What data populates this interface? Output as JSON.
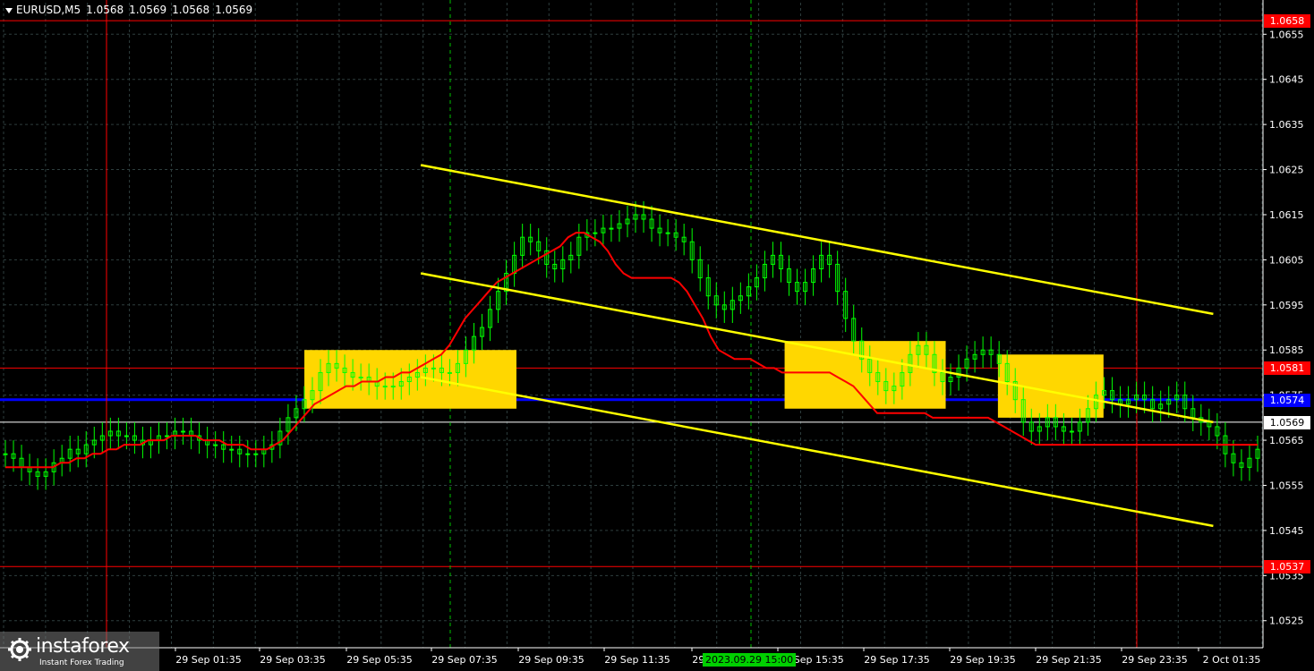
{
  "header": {
    "symbol": "EURUSD,M5",
    "open": "1.0568",
    "high": "1.0569",
    "low": "1.0568",
    "close": "1.0569"
  },
  "watermark": {
    "brand": "instaforex",
    "tagline": "Instant Forex Trading"
  },
  "crosshair_time_label": "2023.09.29 15:00",
  "colors": {
    "background": "#000000",
    "grid": "#2e3e3e",
    "bull_candle": "#00ff00",
    "ma_line": "#ff0000",
    "channel": "#ffff00",
    "box": "#ffd700",
    "support_red": "#ff0000",
    "pivot_blue": "#0000ff",
    "price_tag_red": "#ff0000",
    "price_tag_blue": "#0000ff",
    "time_tag_green": "#00d000"
  },
  "chart_data": {
    "type": "candlestick",
    "ylim": [
      1.0519,
      1.0662
    ],
    "y_ticks": [
      "1.0655",
      "1.0645",
      "1.0635",
      "1.0625",
      "1.0615",
      "1.0605",
      "1.0595",
      "1.0585",
      "1.0575",
      "1.0565",
      "1.0555",
      "1.0545",
      "1.0535",
      "1.0525"
    ],
    "x_ticks": [
      "29 Sep 01:35",
      "29 Sep 03:35",
      "29 Sep 05:35",
      "29 Sep 07:35",
      "29 Sep 09:35",
      "29 Sep 11:35",
      "29 Sep 13:35",
      "29 Sep 15:35",
      "29 Sep 17:35",
      "29 Sep 19:35",
      "29 Sep 21:35",
      "29 Sep 23:35",
      "2 Oct 01:35"
    ],
    "price_levels": [
      {
        "label": "1.0658",
        "value": 1.0658,
        "color": "red"
      },
      {
        "label": "1.0581",
        "value": 1.0581,
        "color": "red"
      },
      {
        "label": "1.0574",
        "value": 1.0574,
        "color": "blue"
      },
      {
        "label": "1.0569",
        "value": 1.0569,
        "color": "white"
      },
      {
        "label": "1.0537",
        "value": 1.0537,
        "color": "red"
      }
    ],
    "vertical_red_lines": [
      "29 Sep 00:00",
      "2 Oct 00:00"
    ],
    "vertical_green_dashed": [
      "29 Sep 07:00",
      "29 Sep 15:00"
    ],
    "channels": [
      {
        "x1": 0.3315,
        "y1": 1.0626,
        "x2": 0.9612,
        "y2": 1.0593
      },
      {
        "x1": 0.3315,
        "y1": 1.0602,
        "x2": 0.9612,
        "y2": 1.0569
      },
      {
        "x1": 0.3315,
        "y1": 1.0579,
        "x2": 0.9612,
        "y2": 1.0546
      }
    ],
    "boxes": [
      {
        "x1": 0.239,
        "x2": 0.4075,
        "y_top": 1.0585,
        "y_bottom": 1.0572
      },
      {
        "x1": 0.6206,
        "x2": 0.7486,
        "y_top": 1.0587,
        "y_bottom": 1.0572
      },
      {
        "x1": 0.7901,
        "x2": 0.874,
        "y_top": 1.0584,
        "y_bottom": 1.057
      }
    ],
    "close_series": [
      1.0562,
      1.0561,
      1.0559,
      1.0558,
      1.0557,
      1.0558,
      1.056,
      1.0561,
      1.0563,
      1.0562,
      1.0564,
      1.0565,
      1.0566,
      1.0567,
      1.0566,
      1.0566,
      1.0565,
      1.0564,
      1.0565,
      1.0566,
      1.0566,
      1.0567,
      1.0567,
      1.0566,
      1.0565,
      1.0564,
      1.0564,
      1.0563,
      1.0563,
      1.0562,
      1.0562,
      1.0562,
      1.0563,
      1.0564,
      1.0567,
      1.057,
      1.0572,
      1.0574,
      1.0576,
      1.058,
      1.0582,
      1.0581,
      1.058,
      1.0579,
      1.0579,
      1.0578,
      1.0577,
      1.0577,
      1.0577,
      1.0578,
      1.0579,
      1.058,
      1.0581,
      1.0581,
      1.058,
      1.058,
      1.0582,
      1.0585,
      1.0588,
      1.059,
      1.0594,
      1.0598,
      1.0602,
      1.0606,
      1.061,
      1.0609,
      1.0607,
      1.0604,
      1.0603,
      1.0605,
      1.0606,
      1.061,
      1.0611,
      1.0611,
      1.0612,
      1.0612,
      1.0613,
      1.0614,
      1.0615,
      1.0614,
      1.0612,
      1.0611,
      1.0611,
      1.061,
      1.0609,
      1.0605,
      1.0601,
      1.0597,
      1.0595,
      1.0594,
      1.0596,
      1.0597,
      1.0599,
      1.0601,
      1.0604,
      1.0606,
      1.0603,
      1.06,
      1.0598,
      1.06,
      1.0603,
      1.0606,
      1.0604,
      1.0598,
      1.0592,
      1.0587,
      1.0583,
      1.058,
      1.0578,
      1.0576,
      1.0577,
      1.058,
      1.0584,
      1.0586,
      1.0584,
      1.058,
      1.0578,
      1.0579,
      1.0581,
      1.0583,
      1.0584,
      1.0585,
      1.0584,
      1.0582,
      1.0578,
      1.0574,
      1.0569,
      1.0567,
      1.0568,
      1.057,
      1.0568,
      1.0567,
      1.0567,
      1.0569,
      1.0572,
      1.0575,
      1.0576,
      1.0574,
      1.0573,
      1.0574,
      1.0575,
      1.0574,
      1.0572,
      1.0573,
      1.0574,
      1.0575,
      1.0572,
      1.057,
      1.0569,
      1.0568,
      1.0566,
      1.0562,
      1.056,
      1.0559,
      1.0561,
      1.0563
    ],
    "ma_series": [
      1.0559,
      1.0559,
      1.0559,
      1.0559,
      1.0559,
      1.0559,
      1.0559,
      1.056,
      1.056,
      1.0561,
      1.0561,
      1.0562,
      1.0562,
      1.0563,
      1.0563,
      1.0564,
      1.0564,
      1.0564,
      1.0565,
      1.0565,
      1.0565,
      1.0566,
      1.0566,
      1.0566,
      1.0566,
      1.0565,
      1.0565,
      1.0565,
      1.0564,
      1.0564,
      1.0564,
      1.0563,
      1.0563,
      1.0563,
      1.0564,
      1.0565,
      1.0567,
      1.0569,
      1.0571,
      1.0573,
      1.0574,
      1.0575,
      1.0576,
      1.0577,
      1.0577,
      1.0578,
      1.0578,
      1.0578,
      1.0579,
      1.0579,
      1.058,
      1.058,
      1.0581,
      1.0582,
      1.0583,
      1.0584,
      1.0586,
      1.0589,
      1.0592,
      1.0594,
      1.0596,
      1.0598,
      1.06,
      1.0601,
      1.0602,
      1.0603,
      1.0604,
      1.0605,
      1.0606,
      1.0607,
      1.0608,
      1.061,
      1.0611,
      1.0611,
      1.061,
      1.0609,
      1.0607,
      1.0604,
      1.0602,
      1.0601,
      1.0601,
      1.0601,
      1.0601,
      1.0601,
      1.0601,
      1.06,
      1.0598,
      1.0595,
      1.0592,
      1.0588,
      1.0585,
      1.0584,
      1.0583,
      1.0583,
      1.0583,
      1.0582,
      1.0581,
      1.0581,
      1.058,
      1.058,
      1.058,
      1.058,
      1.058,
      1.058,
      1.058,
      1.0579,
      1.0578,
      1.0577,
      1.0575,
      1.0573,
      1.0571,
      1.0571,
      1.0571,
      1.0571,
      1.0571,
      1.0571,
      1.0571,
      1.057,
      1.057,
      1.057,
      1.057,
      1.057,
      1.057,
      1.057,
      1.057,
      1.0569,
      1.0568,
      1.0567,
      1.0566,
      1.0565,
      1.0564,
      1.0564,
      1.0564,
      1.0564,
      1.0564,
      1.0564,
      1.0564,
      1.0564,
      1.0564,
      1.0564,
      1.0564,
      1.0564,
      1.0564,
      1.0564,
      1.0564,
      1.0564,
      1.0564,
      1.0564,
      1.0564,
      1.0564,
      1.0564,
      1.0564,
      1.0564,
      1.0564,
      1.0564,
      1.0564,
      1.0564,
      1.0564,
      1.0564
    ]
  }
}
